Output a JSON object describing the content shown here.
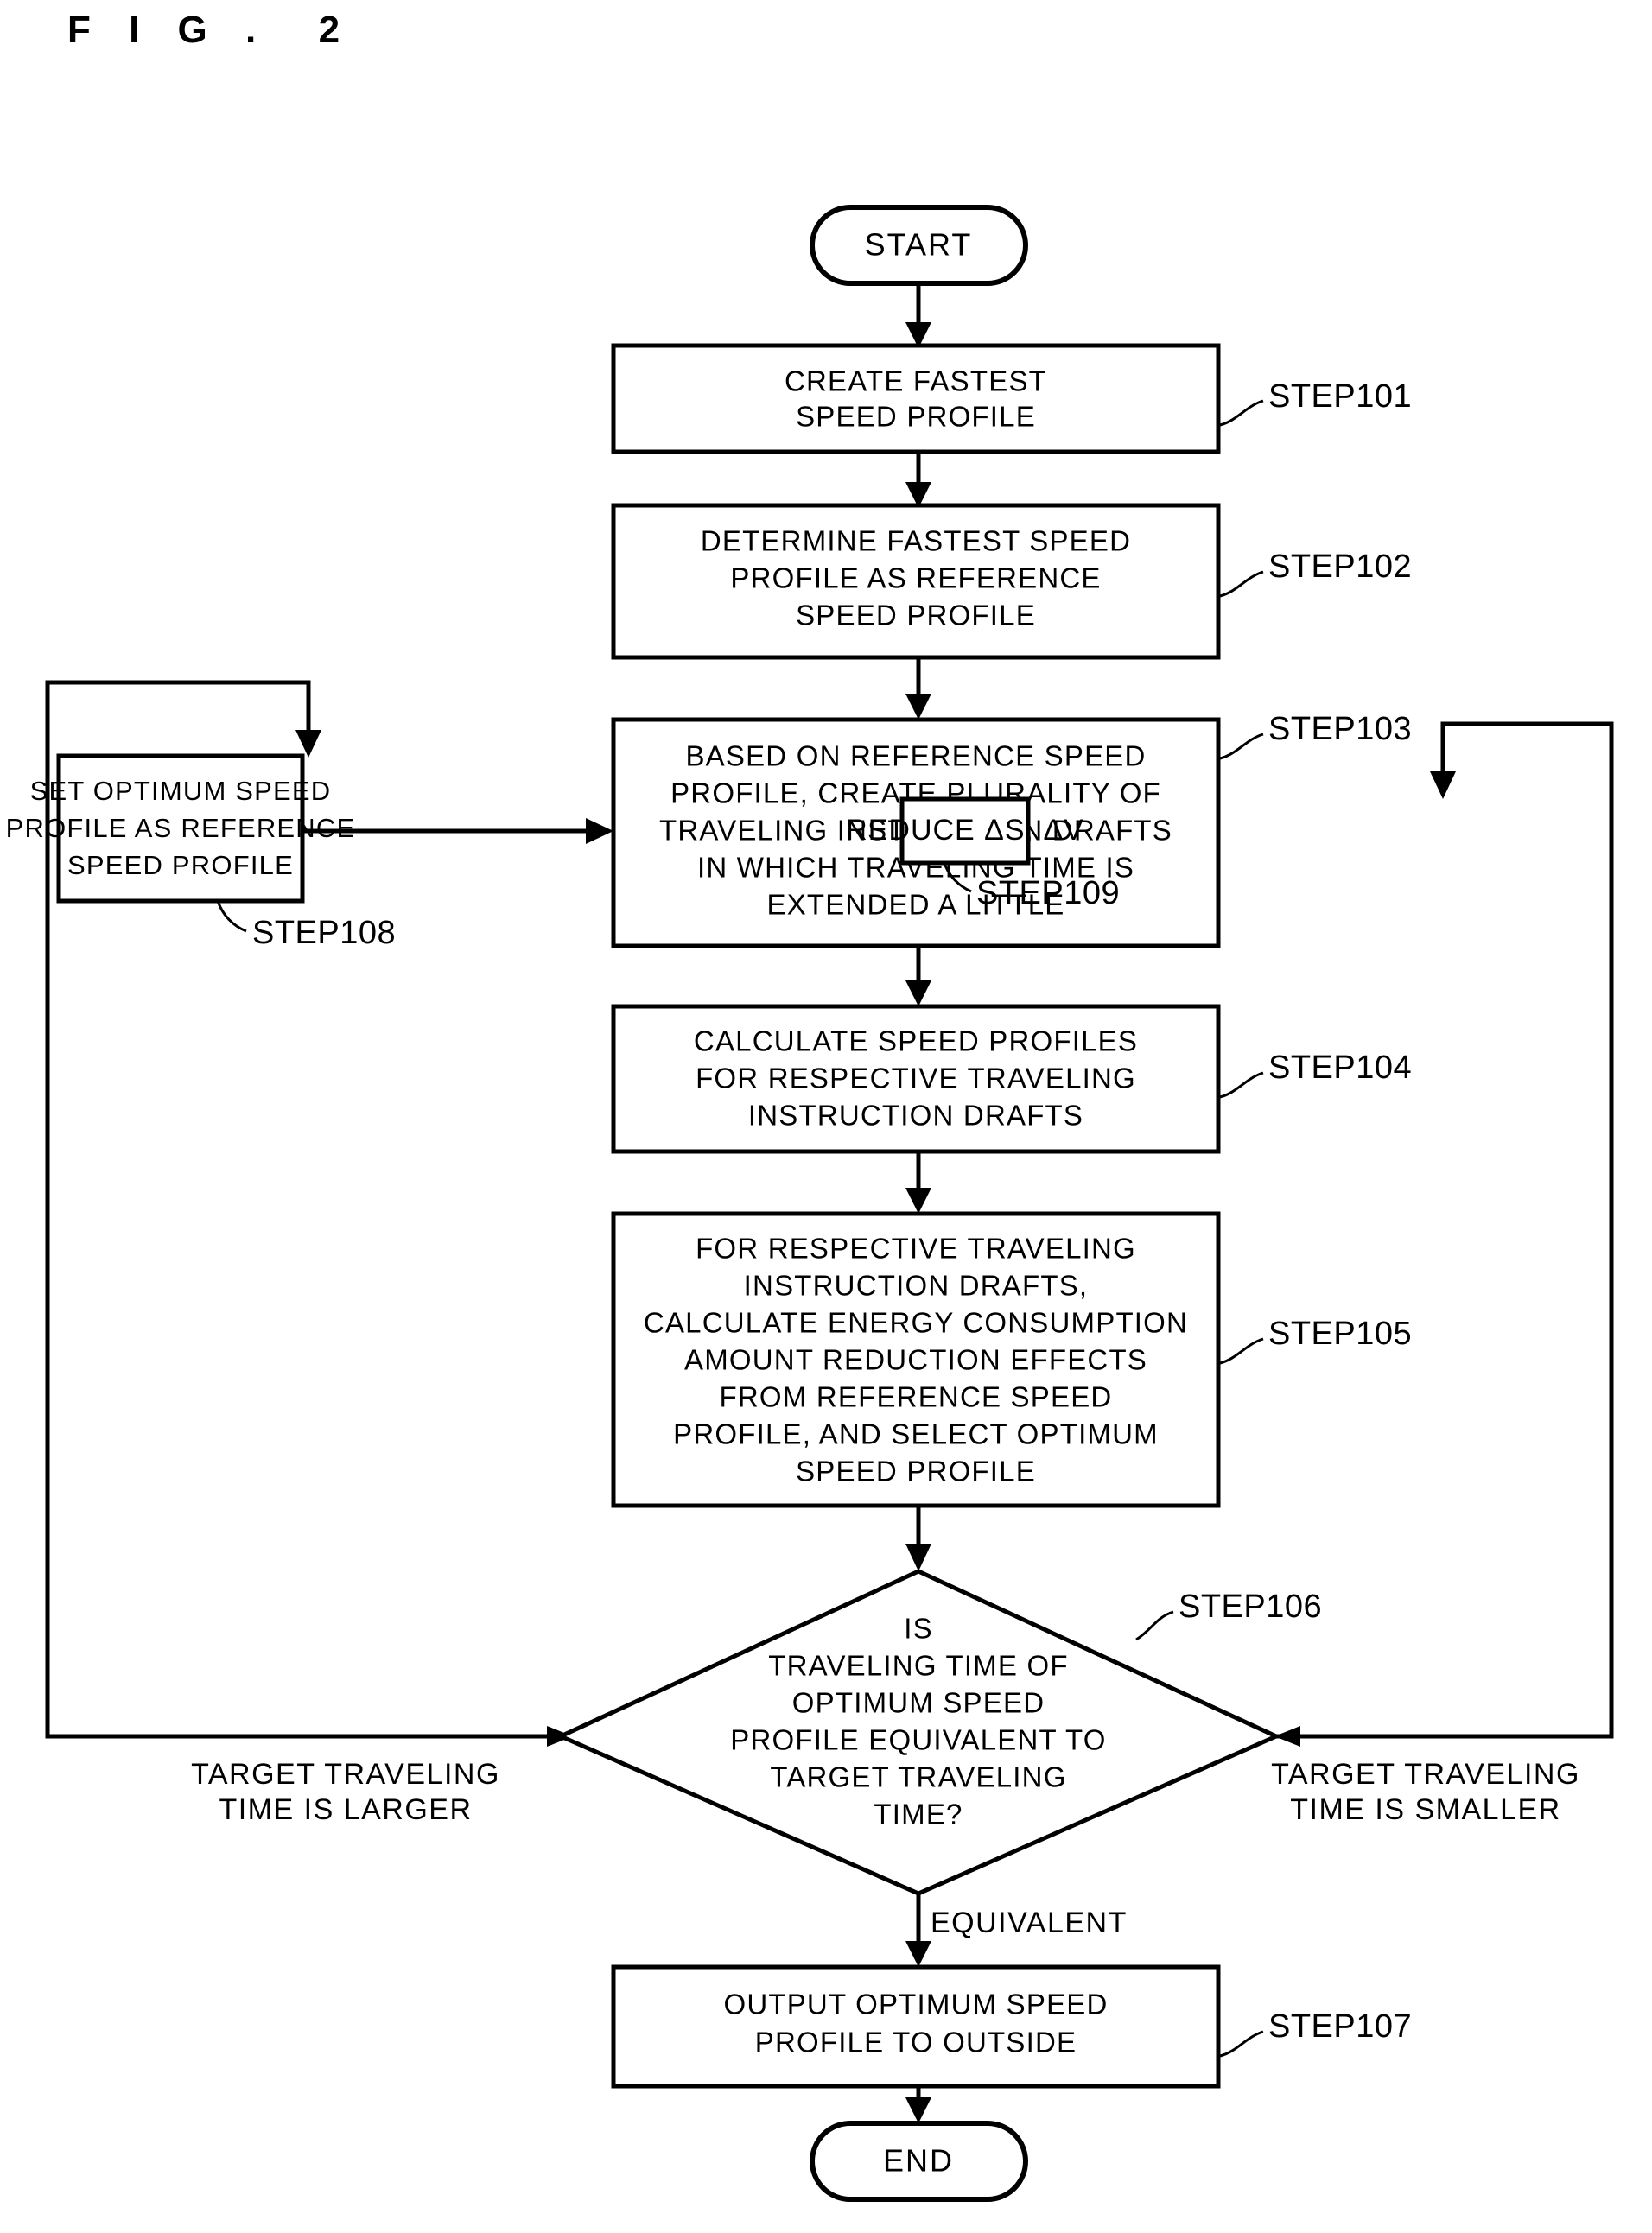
{
  "figure": {
    "title": "F I G .  2"
  },
  "flowchart": {
    "start_node": {
      "label": "START"
    },
    "end_node": {
      "label": "END"
    },
    "steps": [
      {
        "id": "step101",
        "tag": "STEP101",
        "lines": [
          "CREATE FASTEST",
          "SPEED PROFILE"
        ]
      },
      {
        "id": "step102",
        "tag": "STEP102",
        "lines": [
          "DETERMINE FASTEST SPEED",
          "PROFILE AS REFERENCE",
          "SPEED PROFILE"
        ]
      },
      {
        "id": "step103",
        "tag": "STEP103",
        "lines": [
          "BASED ON REFERENCE SPEED",
          "PROFILE, CREATE PLURALITY OF",
          "TRAVELING INSTRUCTION DRAFTS",
          "IN WHICH TRAVELING TIME IS",
          "EXTENDED A LITTLE"
        ]
      },
      {
        "id": "step104",
        "tag": "STEP104",
        "lines": [
          "CALCULATE SPEED PROFILES",
          "FOR RESPECTIVE TRAVELING",
          "INSTRUCTION DRAFTS"
        ]
      },
      {
        "id": "step105",
        "tag": "STEP105",
        "lines": [
          "FOR RESPECTIVE TRAVELING",
          "INSTRUCTION DRAFTS,",
          "CALCULATE ENERGY CONSUMPTION",
          "AMOUNT REDUCTION EFFECTS",
          "FROM REFERENCE SPEED",
          "PROFILE, AND SELECT OPTIMUM",
          "SPEED PROFILE"
        ]
      },
      {
        "id": "step106",
        "tag": "STEP106",
        "lines": [
          "IS",
          "TRAVELING TIME OF",
          "OPTIMUM SPEED",
          "PROFILE EQUIVALENT TO",
          "TARGET TRAVELING",
          "TIME?"
        ]
      },
      {
        "id": "step107",
        "tag": "STEP107",
        "lines": [
          "OUTPUT OPTIMUM SPEED",
          "PROFILE TO OUTSIDE"
        ]
      },
      {
        "id": "step108",
        "tag": "STEP108",
        "lines": [
          "SET OPTIMUM SPEED",
          "PROFILE AS REFERENCE",
          "SPEED PROFILE"
        ]
      },
      {
        "id": "step109",
        "tag": "STEP109",
        "lines": [
          "REDUCE ΔS, ΔV"
        ]
      }
    ],
    "edge_labels": {
      "left_branch_line1": "TARGET TRAVELING",
      "left_branch_line2": "TIME IS LARGER",
      "right_branch_line1": "TARGET TRAVELING",
      "right_branch_line2": "TIME IS SMALLER",
      "bottom_branch": "EQUIVALENT"
    }
  },
  "colors": {
    "ink": "#000000",
    "paper": "#ffffff"
  }
}
